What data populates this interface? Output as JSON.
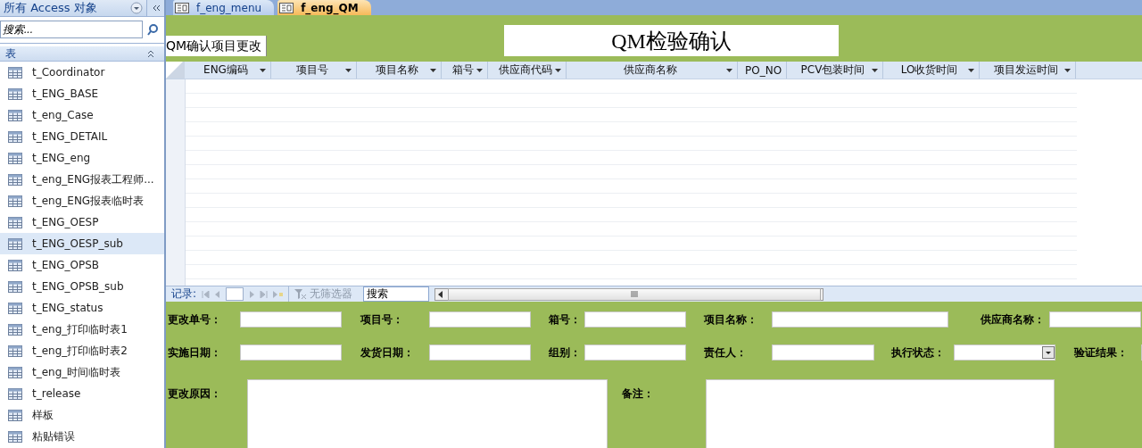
{
  "nav_pane": {
    "title": "所有 Access 对象",
    "search": {
      "placeholder": "搜索..."
    },
    "group": {
      "label": "表",
      "expanded": true
    },
    "items": [
      {
        "label": "t_Coordinator",
        "selected": false
      },
      {
        "label": "t_ENG_BASE",
        "selected": false
      },
      {
        "label": "t_eng_Case",
        "selected": false
      },
      {
        "label": "t_ENG_DETAIL",
        "selected": false
      },
      {
        "label": "t_ENG_eng",
        "selected": false
      },
      {
        "label": "t_eng_ENG报表工程师...",
        "selected": false
      },
      {
        "label": "t_eng_ENG报表临时表",
        "selected": false
      },
      {
        "label": "t_ENG_OESP",
        "selected": false
      },
      {
        "label": "t_ENG_OESP_sub",
        "selected": true
      },
      {
        "label": "t_ENG_OPSB",
        "selected": false
      },
      {
        "label": "t_ENG_OPSB_sub",
        "selected": false
      },
      {
        "label": "t_ENG_status",
        "selected": false
      },
      {
        "label": "t_eng_打印临时表1",
        "selected": false
      },
      {
        "label": "t_eng_打印临时表2",
        "selected": false
      },
      {
        "label": "t_eng_时间临时表",
        "selected": false
      },
      {
        "label": "t_release",
        "selected": false
      },
      {
        "label": "样板",
        "selected": false
      },
      {
        "label": "粘贴错误",
        "selected": false
      }
    ]
  },
  "document_tabs": [
    {
      "label": "f_eng_menu",
      "selected": false
    },
    {
      "label": "f_eng_QM",
      "selected": true
    }
  ],
  "form": {
    "title": "QM检验确认",
    "subform_tab": "QM确认项目更改",
    "datasheet": {
      "columns": [
        "ENG编码",
        "项目号",
        "项目名称",
        "箱号",
        "供应商代码",
        "供应商名称",
        "PO_NO",
        "PCV包装时间",
        "LO收货时间",
        "项目发运时间"
      ]
    },
    "record_nav": {
      "label": "记录:",
      "filter": "无筛选器",
      "search": "搜索"
    },
    "rows": [
      [
        {
          "label": "更改单号：",
          "kind": "text"
        },
        {
          "label": "项目号：",
          "kind": "text"
        },
        {
          "label": "箱号：",
          "kind": "text"
        },
        {
          "label": "项目名称：",
          "kind": "text"
        },
        {
          "label": "供应商名称：",
          "kind": "text"
        }
      ],
      [
        {
          "label": "实施日期：",
          "kind": "text"
        },
        {
          "label": "发货日期：",
          "kind": "text"
        },
        {
          "label": "组别：",
          "kind": "text"
        },
        {
          "label": "责任人：",
          "kind": "text"
        },
        {
          "label": "执行状态：",
          "kind": "combo"
        },
        {
          "label": "验证结果：",
          "kind": "text"
        }
      ],
      [
        {
          "label": "更改原因：",
          "kind": "memo"
        },
        {
          "label": "备注：",
          "kind": "memo"
        }
      ]
    ]
  }
}
